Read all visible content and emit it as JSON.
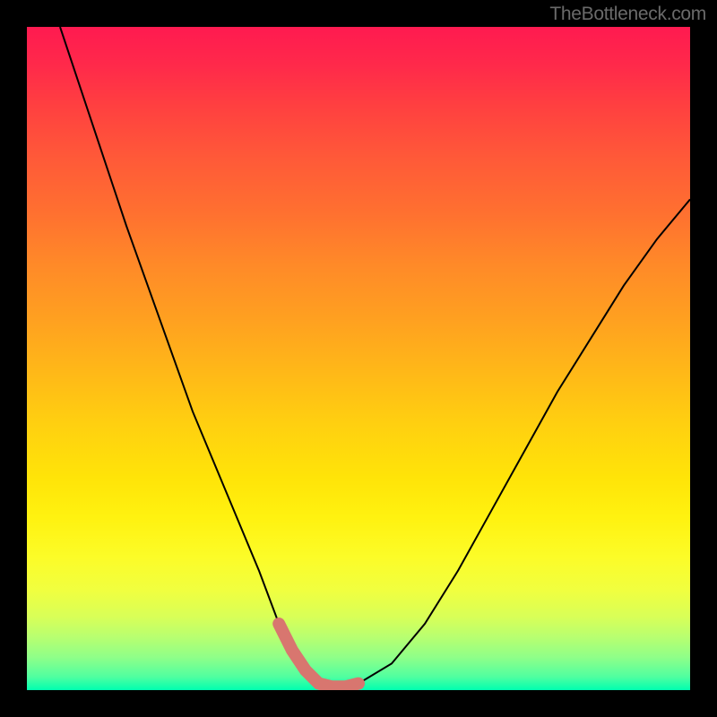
{
  "watermark": "TheBottleneck.com",
  "chart_data": {
    "type": "line",
    "title": "",
    "xlabel": "",
    "ylabel": "",
    "xlim": [
      0,
      100
    ],
    "ylim": [
      0,
      100
    ],
    "grid": false,
    "legend": false,
    "series": [
      {
        "name": "bottleneck-curve",
        "x": [
          5,
          10,
          15,
          20,
          25,
          30,
          35,
          38,
          40,
          42,
          44,
          46,
          48,
          50,
          55,
          60,
          65,
          70,
          75,
          80,
          85,
          90,
          95,
          100
        ],
        "y": [
          100,
          85,
          70,
          56,
          42,
          30,
          18,
          10,
          6,
          3,
          1,
          0.5,
          0.5,
          1,
          4,
          10,
          18,
          27,
          36,
          45,
          53,
          61,
          68,
          74
        ]
      }
    ],
    "annotations": [
      {
        "name": "optimal-zone-marker",
        "x_range": [
          38,
          50
        ],
        "y_range": [
          0.5,
          10
        ],
        "color": "#d8766f"
      }
    ],
    "gradient_stops": [
      {
        "pos": 0,
        "color": "#ff1a50"
      },
      {
        "pos": 50,
        "color": "#ffc010"
      },
      {
        "pos": 80,
        "color": "#fcfc28"
      },
      {
        "pos": 100,
        "color": "#00ffb0"
      }
    ]
  }
}
